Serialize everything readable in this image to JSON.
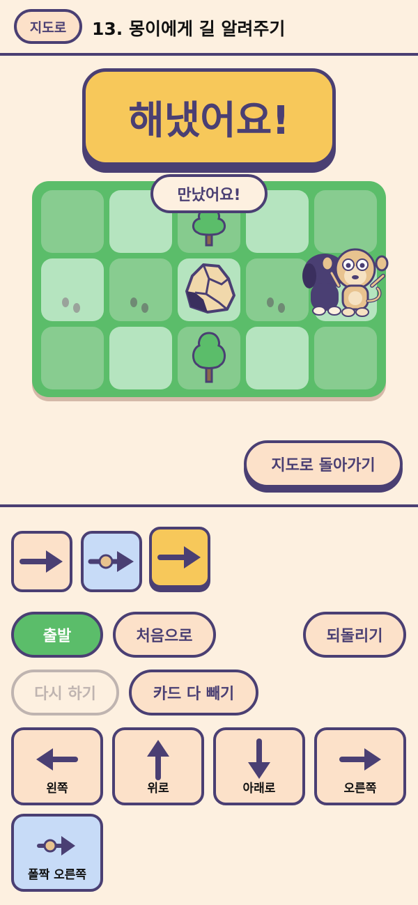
{
  "header": {
    "map_button": "지도로",
    "level_title": "13. 몽이에게 길 알려주기"
  },
  "result": {
    "banner": "해냈어요!",
    "bubble": "만났어요!"
  },
  "board": {
    "rows": 3,
    "cols": 5,
    "objects": {
      "trees": [
        "tree-top-middle",
        "tree-bottom-middle"
      ],
      "rock": "rock-center",
      "characters": [
        "monkey",
        "dog"
      ]
    }
  },
  "back_to_map_button": "지도로 돌아가기",
  "sequence": {
    "cards": [
      {
        "type": "right",
        "icon": "right-arrow-icon"
      },
      {
        "type": "jump-right",
        "icon": "jump-right-icon"
      },
      {
        "type": "right",
        "icon": "right-arrow-icon"
      }
    ]
  },
  "controls": {
    "start": "출발",
    "reset": "처음으로",
    "undo": "되돌리기",
    "retry": "다시 하기",
    "clear_cards": "카드 다 빼기"
  },
  "directions": {
    "left": "왼쪽",
    "up": "위로",
    "down": "아래로",
    "right": "오른쪽",
    "jump_right": "폴짝 오른쪽"
  },
  "colors": {
    "outline": "#4a3f73",
    "background": "#fdf0e0",
    "peach": "#fce1c9",
    "yellow": "#f7c85a",
    "green": "#5bbd6a",
    "blue": "#c7dbf7"
  }
}
